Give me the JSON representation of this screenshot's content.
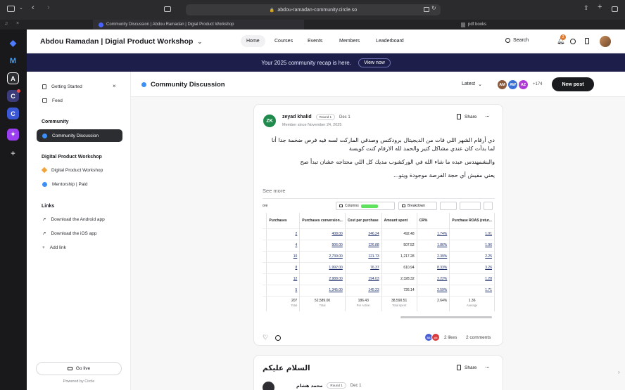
{
  "browser": {
    "url": "abdou-ramadan-community.circle.so",
    "tabs": [
      {
        "label": "Community Discussion | Abdou Ramadan | Digial Product Workshop",
        "active": true
      },
      {
        "label": "pdf books",
        "active": false
      }
    ]
  },
  "rail": {
    "items": [
      "A",
      "C",
      "C"
    ]
  },
  "header": {
    "title": "Abdou Ramadan | Digial Product Workshop",
    "nav": [
      "Home",
      "Courses",
      "Events",
      "Members",
      "Leaderboard"
    ],
    "search_label": "Search",
    "notification_count": "2"
  },
  "banner": {
    "text": "Your 2025 community recap is here.",
    "button": "View now"
  },
  "sidebar": {
    "getting_started": "Getting Started",
    "feed": "Feed",
    "sections": [
      {
        "heading": "Community",
        "items": [
          "Community Discussion"
        ]
      },
      {
        "heading": "Digital Product Workshop",
        "items": [
          "Digital Product Workshop",
          "Mentorship | Paid"
        ]
      },
      {
        "heading": "Links",
        "items": [
          "Download the Android app",
          "Download the iOS app",
          "Add link"
        ]
      }
    ],
    "go_live": "Go live",
    "powered_by": "Powered by Circle"
  },
  "feed": {
    "title": "Community Discussion",
    "sort": "Latest",
    "member_avatars": [
      "AM",
      "AW",
      "AZ"
    ],
    "member_extra": "+174",
    "new_post": "New post"
  },
  "post1": {
    "avatar": "ZK",
    "author": "zeyad khalid",
    "badge": "Round 1",
    "date": "Dec 1",
    "member_since": "Member since November 24, 2025",
    "share": "Share",
    "paragraphs": [
      "دي أرقام الشهر اللي فات من الديجيتال برودكتس وصدقي الماركت لسه فيه فرص ضخمة جدا أنا",
      "لما بدأت كان عندي مشاكل كتير والحمد لله الارقام كنت كويسة",
      "والبشمهندس عبده ما شاء الله في الوركشوب مديك كل اللي محتاجه عشان تبدأ صح",
      "يعني مفيش أي حجة الفرصة موجودة ويتو..."
    ],
    "see_more": "See more",
    "likes": "2 likes",
    "comments": "2 comments",
    "liker_avatars": [
      "SS",
      "@l"
    ]
  },
  "sheet": {
    "toolbar": {
      "left": "ore",
      "columns": "Columns",
      "breakdown": "Breakdown"
    },
    "headers": [
      "Purchases",
      "Purchases conversion...",
      "Cost per purchase",
      "Amount spent",
      "CR%",
      "Purchase ROAS (retur..."
    ],
    "rows": [
      [
        "2",
        "408.00",
        "246.24",
        "492.48",
        "1.74%",
        "1.01"
      ],
      [
        "4",
        "906.00",
        "126.88",
        "507.52",
        "1.86%",
        "1.96"
      ],
      [
        "10",
        "2,739.00",
        "121.73",
        "1,217.28",
        "2.39%",
        "2.25"
      ],
      [
        "8",
        "1,992.00",
        "76.37",
        "610.94",
        "8.33%",
        "3.26"
      ],
      [
        "12",
        "2,988.00",
        "194.03",
        "2,328.32",
        "2.22%",
        "1.28"
      ],
      [
        "5",
        "1,345.00",
        "145.23",
        "726.14",
        "2.59%",
        "1.71"
      ]
    ],
    "totals": [
      "207",
      "52,589.00",
      "186.43",
      "38,590.51",
      "2.64%",
      "1.36"
    ],
    "totals_sub": [
      "Total",
      "Total",
      "Per Action",
      "Total spent",
      "",
      "Average"
    ]
  },
  "post2": {
    "title": "السلام عليكم",
    "author": "محمد هشام",
    "badge": "Round 1",
    "date": "Dec 1",
    "share": "Share"
  }
}
